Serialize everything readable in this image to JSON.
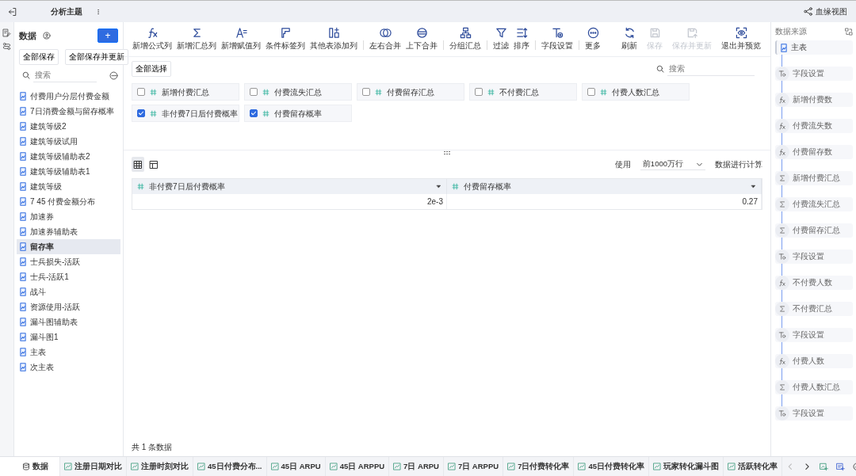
{
  "topbar": {
    "title": "分析主题",
    "lineage_button": "血缘视图"
  },
  "sidebar": {
    "title": "数据",
    "add_button": "+",
    "save_all": "全部保存",
    "save_all_update": "全部保存并更新",
    "search_placeholder": "搜索",
    "items": [
      {
        "label": "付费用户分层付费金额",
        "selected": false
      },
      {
        "label": "7日消费金额与留存概率",
        "selected": false
      },
      {
        "label": "建筑等级2",
        "selected": false
      },
      {
        "label": "建筑等级试用",
        "selected": false
      },
      {
        "label": "建筑等级辅助表2",
        "selected": false
      },
      {
        "label": "建筑等级辅助表1",
        "selected": false
      },
      {
        "label": "建筑等级",
        "selected": false
      },
      {
        "label": "7 45 付费金额分布",
        "selected": false
      },
      {
        "label": "加速券",
        "selected": false
      },
      {
        "label": "加速券辅助表",
        "selected": false
      },
      {
        "label": "留存率",
        "selected": true
      },
      {
        "label": "士兵损失-活跃",
        "selected": false
      },
      {
        "label": "士兵-活跃1",
        "selected": false
      },
      {
        "label": "战斗",
        "selected": false
      },
      {
        "label": "资源使用-活跃",
        "selected": false
      },
      {
        "label": "漏斗图辅助表",
        "selected": false
      },
      {
        "label": "漏斗图1",
        "selected": false
      },
      {
        "label": "主表",
        "selected": false
      },
      {
        "label": "次主表",
        "selected": false
      }
    ]
  },
  "toolbar": {
    "groups": [
      [
        {
          "label": "新增公式列",
          "kind": "formula"
        },
        {
          "label": "新增汇总列",
          "kind": "sum"
        },
        {
          "label": "新增赋值列",
          "kind": "assign"
        },
        {
          "label": "条件标签列",
          "kind": "tag"
        },
        {
          "label": "其他表添加列",
          "kind": "addcol"
        }
      ],
      [
        {
          "label": "左右合并",
          "kind": "merge-lr"
        },
        {
          "label": "上下合并",
          "kind": "merge-tb"
        }
      ],
      [
        {
          "label": "分组汇总",
          "kind": "group"
        }
      ],
      [
        {
          "label": "过滤",
          "kind": "filter"
        },
        {
          "label": "排序",
          "kind": "sort"
        }
      ],
      [
        {
          "label": "字段设置",
          "kind": "field"
        }
      ],
      [
        {
          "label": "更多",
          "kind": "more"
        }
      ]
    ],
    "right": [
      {
        "label": "刷新",
        "kind": "refresh",
        "disabled": false
      },
      {
        "label": "保存",
        "kind": "save",
        "disabled": true
      },
      {
        "label": "保存并更新",
        "kind": "save-update",
        "disabled": true
      },
      {
        "label": "退出并预览",
        "kind": "preview",
        "disabled": false
      }
    ]
  },
  "fields": {
    "select_all": "全部选择",
    "search_placeholder": "搜索",
    "items": [
      {
        "label": "新增付费汇总",
        "checked": false
      },
      {
        "label": "付费流失汇总",
        "checked": false
      },
      {
        "label": "付费留存汇总",
        "checked": false
      },
      {
        "label": "不付费汇总",
        "checked": false
      },
      {
        "label": "付费人数汇总",
        "checked": false
      },
      {
        "label": "非付费7日后付费概率",
        "checked": true
      },
      {
        "label": "付费留存概率",
        "checked": true
      }
    ]
  },
  "preview": {
    "view_modes": [
      {
        "kind": "grid",
        "selected": true
      },
      {
        "kind": "layout",
        "selected": false
      }
    ],
    "use_label": "使用",
    "row_limit": "前1000万行",
    "compute_label": "数据进行计算",
    "columns": [
      "非付费7日后付费概率",
      "付费留存概率"
    ],
    "rows": [
      [
        "2e-3",
        "0.27"
      ]
    ],
    "footer": "共 1 条数据"
  },
  "source_panel": {
    "title": "数据来源",
    "steps": [
      {
        "kind": "table",
        "label": "主表",
        "selected": true
      },
      {
        "kind": "field",
        "label": "字段设置",
        "selected": false
      },
      {
        "kind": "formula",
        "label": "新增付费数",
        "selected": false
      },
      {
        "kind": "formula",
        "label": "付费流失数",
        "selected": false
      },
      {
        "kind": "formula",
        "label": "付费留存数",
        "selected": false
      },
      {
        "kind": "sum",
        "label": "新增付费汇总",
        "selected": false
      },
      {
        "kind": "sum",
        "label": "付费流失汇总",
        "selected": false
      },
      {
        "kind": "sum",
        "label": "付费留存汇总",
        "selected": false
      },
      {
        "kind": "field",
        "label": "字段设置",
        "selected": false
      },
      {
        "kind": "formula",
        "label": "不付费人数",
        "selected": false
      },
      {
        "kind": "sum",
        "label": "不付费汇总",
        "selected": false
      },
      {
        "kind": "field",
        "label": "字段设置",
        "selected": false
      },
      {
        "kind": "formula",
        "label": "付费人数",
        "selected": false
      },
      {
        "kind": "sum",
        "label": "付费人数汇总",
        "selected": false
      },
      {
        "kind": "field",
        "label": "字段设置",
        "selected": false
      }
    ]
  },
  "bottom_tabs": [
    {
      "label": "数据",
      "kind": "data",
      "selected": true
    },
    {
      "label": "注册日期对比",
      "kind": "report",
      "selected": false
    },
    {
      "label": "注册时刻对比",
      "kind": "report",
      "selected": false
    },
    {
      "label": "45日付费分布...",
      "kind": "report",
      "selected": false
    },
    {
      "label": "45日 ARPU",
      "kind": "report",
      "selected": false
    },
    {
      "label": "45日 ARPPU",
      "kind": "report",
      "selected": false
    },
    {
      "label": "7日 ARPU",
      "kind": "report",
      "selected": false
    },
    {
      "label": "7日 ARPPU",
      "kind": "report",
      "selected": false
    },
    {
      "label": "7日付费转化率",
      "kind": "report",
      "selected": false
    },
    {
      "label": "45日付费转化率",
      "kind": "report",
      "selected": false
    },
    {
      "label": "玩家转化漏斗图",
      "kind": "report",
      "selected": false
    },
    {
      "label": "活跃转化率",
      "kind": "report",
      "selected": false
    }
  ]
}
